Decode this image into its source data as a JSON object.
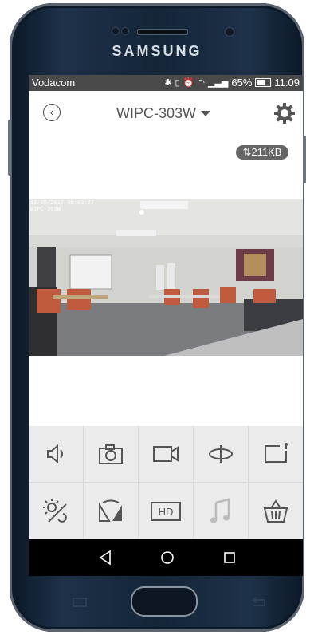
{
  "device": {
    "brand": "SAMSUNG"
  },
  "statusbar": {
    "carrier": "Vodacom",
    "battery": "65%",
    "time": "11:09"
  },
  "appbar": {
    "title": "WIPC-303W"
  },
  "stream": {
    "rate": "211KB",
    "timestamp": "16/05/2017 08:03:27",
    "camera_name": "WIPC-303W"
  },
  "toolbar": {
    "row1": [
      "speaker-icon",
      "camera-icon",
      "video-record-icon",
      "rotate-icon",
      "share-icon"
    ],
    "row2": [
      "brightness-icon",
      "flip-icon",
      "hd-icon",
      "music-icon",
      "cart-icon"
    ],
    "hd_label": "HD"
  },
  "colors": {
    "statusbar": "#4a4a4a",
    "toolbar_bg": "#ebebeb",
    "icon": "#555555",
    "disabled_icon": "#bbbbbb"
  }
}
